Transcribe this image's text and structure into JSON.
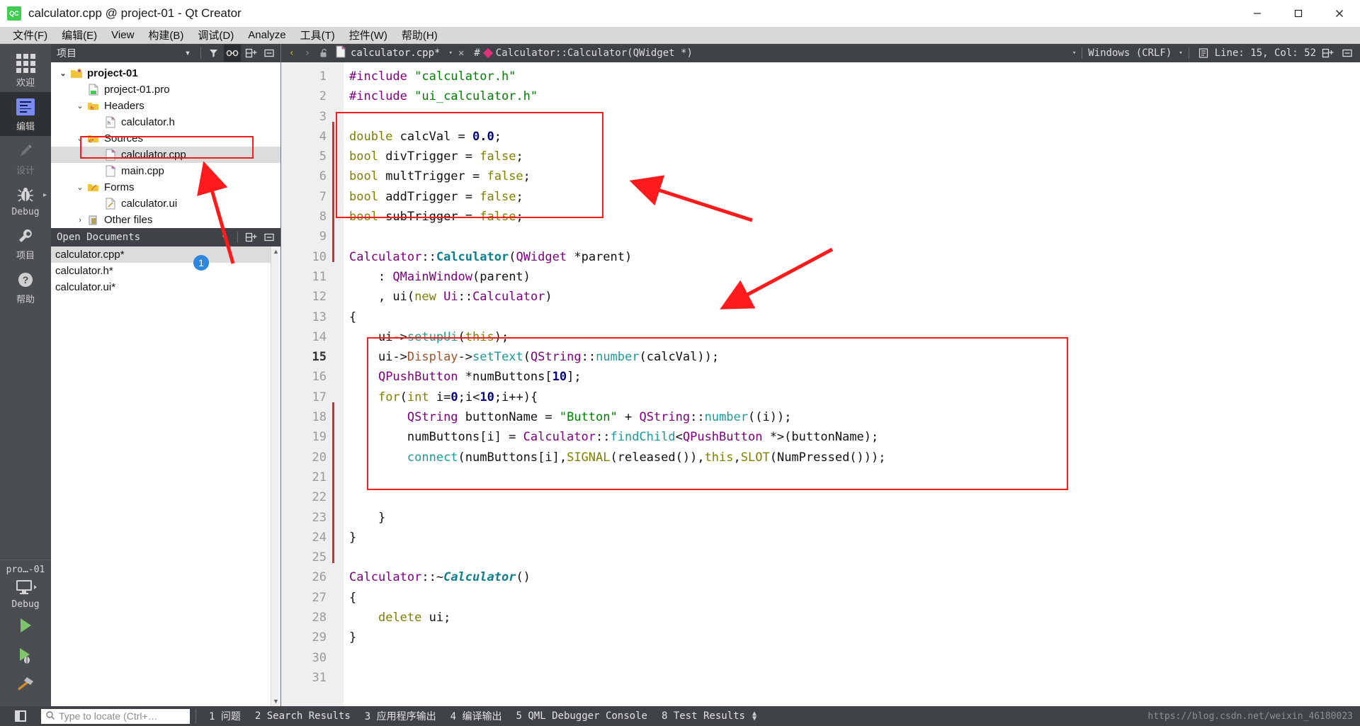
{
  "window": {
    "title": "calculator.cpp @ project-01 - Qt Creator",
    "logo_text": "QC",
    "minimize": "–",
    "maximize": "□",
    "close": "✕"
  },
  "menubar": {
    "items": [
      {
        "label": "文件(F)",
        "name": "menu-file"
      },
      {
        "label": "编辑(E)",
        "name": "menu-edit"
      },
      {
        "label": "View",
        "name": "menu-view"
      },
      {
        "label": "构建(B)",
        "name": "menu-build"
      },
      {
        "label": "调试(D)",
        "name": "menu-debug"
      },
      {
        "label": "Analyze",
        "name": "menu-analyze"
      },
      {
        "label": "工具(T)",
        "name": "menu-tools"
      },
      {
        "label": "控件(W)",
        "name": "menu-window"
      },
      {
        "label": "帮助(H)",
        "name": "menu-help"
      }
    ]
  },
  "modebar": {
    "items": [
      {
        "label": "欢迎",
        "icon": "grid-icon",
        "name": "mode-welcome",
        "active": false
      },
      {
        "label": "编辑",
        "icon": "edit-icon",
        "name": "mode-edit",
        "active": true
      },
      {
        "label": "设计",
        "icon": "pencil-icon",
        "name": "mode-design",
        "active": false
      },
      {
        "label": "Debug",
        "icon": "bug-icon",
        "name": "mode-debug",
        "active": false
      },
      {
        "label": "项目",
        "icon": "wrench-icon",
        "name": "mode-projects",
        "active": false
      },
      {
        "label": "帮助",
        "icon": "help-icon",
        "name": "mode-help",
        "active": false
      }
    ],
    "kit": {
      "project": "pro…-01",
      "build_config": "Debug",
      "run_icon": "play-icon",
      "debug_icon": "play-debug-icon",
      "build_icon": "hammer-icon"
    }
  },
  "project_panel": {
    "title": "项目",
    "tools": [
      "filter-icon",
      "link-icon",
      "split-icon",
      "close-panel-icon"
    ],
    "tree": [
      {
        "label": "project-01",
        "indent": 0,
        "arrow": "⌄",
        "icon": "project-icon",
        "bold": true,
        "selected": false
      },
      {
        "label": "project-01.pro",
        "indent": 1,
        "arrow": "",
        "icon": "pro-file-icon",
        "bold": false,
        "selected": false
      },
      {
        "label": "Headers",
        "indent": 1,
        "arrow": "⌄",
        "icon": "folder-h-icon",
        "bold": false,
        "selected": false
      },
      {
        "label": "calculator.h",
        "indent": 2,
        "arrow": "",
        "icon": "header-icon",
        "bold": false,
        "selected": false
      },
      {
        "label": "Sources",
        "indent": 1,
        "arrow": "⌄",
        "icon": "folder-c-icon",
        "bold": false,
        "selected": false
      },
      {
        "label": "calculator.cpp",
        "indent": 2,
        "arrow": "",
        "icon": "cpp-file-icon",
        "bold": false,
        "selected": true
      },
      {
        "label": "main.cpp",
        "indent": 2,
        "arrow": "",
        "icon": "cpp-file-icon",
        "bold": false,
        "selected": false
      },
      {
        "label": "Forms",
        "indent": 1,
        "arrow": "⌄",
        "icon": "folder-ui-icon",
        "bold": false,
        "selected": false
      },
      {
        "label": "calculator.ui",
        "indent": 2,
        "arrow": "",
        "icon": "ui-file-icon",
        "bold": false,
        "selected": false
      },
      {
        "label": "Other files",
        "indent": 1,
        "arrow": "›",
        "icon": "other-icon",
        "bold": false,
        "selected": false
      }
    ],
    "callout_number": "1"
  },
  "open_documents": {
    "title": "Open Documents",
    "items": [
      {
        "label": "calculator.cpp*",
        "selected": true
      },
      {
        "label": "calculator.h*",
        "selected": false
      },
      {
        "label": "calculator.ui*",
        "selected": false
      }
    ]
  },
  "editor_toolbar": {
    "back": "‹",
    "forward": "›",
    "lock_icon": "unlock-icon",
    "file_icon": "cpp-file-icon",
    "file_name": "calculator.cpp*",
    "close_label": "✕",
    "hash_label": "#",
    "symbol": "Calculator::Calculator(QWidget *)",
    "line_ending": "Windows (CRLF)",
    "cursor_position": "Line: 15, Col: 52",
    "split_icon": "split-icon",
    "close_split_icon": "close-split-icon"
  },
  "editor": {
    "first_line": 1,
    "last_line": 31,
    "current_line": 15,
    "fold_lines": [
      12,
      17,
      26
    ],
    "lines": [
      {
        "n": 1,
        "tokens": [
          {
            "t": "#include ",
            "c": "pre"
          },
          {
            "t": "\"calculator.h\"",
            "c": "str"
          }
        ]
      },
      {
        "n": 2,
        "tokens": [
          {
            "t": "#include ",
            "c": "pre"
          },
          {
            "t": "\"ui_calculator.h\"",
            "c": "str"
          }
        ]
      },
      {
        "n": 3,
        "tokens": []
      },
      {
        "n": 4,
        "tokens": [
          {
            "t": "double",
            "c": "kw"
          },
          {
            "t": " calcVal = ",
            "c": "op"
          },
          {
            "t": "0.0",
            "c": "num"
          },
          {
            "t": ";",
            "c": "op"
          }
        ]
      },
      {
        "n": 5,
        "tokens": [
          {
            "t": "bool",
            "c": "kw"
          },
          {
            "t": " divTrigger = ",
            "c": "op"
          },
          {
            "t": "false",
            "c": "kw"
          },
          {
            "t": ";",
            "c": "op"
          }
        ]
      },
      {
        "n": 6,
        "tokens": [
          {
            "t": "bool",
            "c": "kw"
          },
          {
            "t": " multTrigger = ",
            "c": "op"
          },
          {
            "t": "false",
            "c": "kw"
          },
          {
            "t": ";",
            "c": "op"
          }
        ]
      },
      {
        "n": 7,
        "tokens": [
          {
            "t": "bool",
            "c": "kw"
          },
          {
            "t": " addTrigger = ",
            "c": "op"
          },
          {
            "t": "false",
            "c": "kw"
          },
          {
            "t": ";",
            "c": "op"
          }
        ]
      },
      {
        "n": 8,
        "tokens": [
          {
            "t": "bool",
            "c": "kw"
          },
          {
            "t": " subTrigger = ",
            "c": "op"
          },
          {
            "t": "false",
            "c": "kw"
          },
          {
            "t": ";",
            "c": "op"
          }
        ]
      },
      {
        "n": 9,
        "tokens": []
      },
      {
        "n": 10,
        "tokens": [
          {
            "t": "Calculator",
            "c": "typ"
          },
          {
            "t": "::",
            "c": "op"
          },
          {
            "t": "Calculator",
            "c": "cls"
          },
          {
            "t": "(",
            "c": "op"
          },
          {
            "t": "QWidget",
            "c": "typ"
          },
          {
            "t": " *parent)",
            "c": "op"
          }
        ]
      },
      {
        "n": 11,
        "tokens": [
          {
            "t": "    : ",
            "c": "op"
          },
          {
            "t": "QMainWindow",
            "c": "typ"
          },
          {
            "t": "(parent)",
            "c": "op"
          }
        ]
      },
      {
        "n": 12,
        "tokens": [
          {
            "t": "    , ui(",
            "c": "op"
          },
          {
            "t": "new",
            "c": "kw"
          },
          {
            "t": " ",
            "c": "op"
          },
          {
            "t": "Ui",
            "c": "typ"
          },
          {
            "t": "::",
            "c": "op"
          },
          {
            "t": "Calculator",
            "c": "typ"
          },
          {
            "t": ")",
            "c": "op"
          }
        ]
      },
      {
        "n": 13,
        "tokens": [
          {
            "t": "{",
            "c": "op"
          }
        ]
      },
      {
        "n": 14,
        "tokens": [
          {
            "t": "    ui->",
            "c": "op"
          },
          {
            "t": "setupUi",
            "c": "fn"
          },
          {
            "t": "(",
            "c": "op"
          },
          {
            "t": "this",
            "c": "kw"
          },
          {
            "t": ");",
            "c": "op"
          }
        ]
      },
      {
        "n": 15,
        "tokens": [
          {
            "t": "    ui->",
            "c": "op"
          },
          {
            "t": "Display",
            "c": "fld"
          },
          {
            "t": "->",
            "c": "op"
          },
          {
            "t": "setText",
            "c": "fn"
          },
          {
            "t": "(",
            "c": "op"
          },
          {
            "t": "QString",
            "c": "typ"
          },
          {
            "t": "::",
            "c": "op"
          },
          {
            "t": "number",
            "c": "fn"
          },
          {
            "t": "(calcVal));",
            "c": "op"
          }
        ]
      },
      {
        "n": 16,
        "tokens": [
          {
            "t": "    ",
            "c": "op"
          },
          {
            "t": "QPushButton",
            "c": "typ"
          },
          {
            "t": " *numButtons[",
            "c": "op"
          },
          {
            "t": "10",
            "c": "num"
          },
          {
            "t": "];",
            "c": "op"
          }
        ]
      },
      {
        "n": 17,
        "tokens": [
          {
            "t": "    ",
            "c": "op"
          },
          {
            "t": "for",
            "c": "kw"
          },
          {
            "t": "(",
            "c": "op"
          },
          {
            "t": "int",
            "c": "kw"
          },
          {
            "t": " i=",
            "c": "op"
          },
          {
            "t": "0",
            "c": "num"
          },
          {
            "t": ";i<",
            "c": "op"
          },
          {
            "t": "10",
            "c": "num"
          },
          {
            "t": ";i++){",
            "c": "op"
          }
        ]
      },
      {
        "n": 18,
        "tokens": [
          {
            "t": "        ",
            "c": "op"
          },
          {
            "t": "QString",
            "c": "typ"
          },
          {
            "t": " buttonName = ",
            "c": "op"
          },
          {
            "t": "\"Button\"",
            "c": "str"
          },
          {
            "t": " + ",
            "c": "op"
          },
          {
            "t": "QString",
            "c": "typ"
          },
          {
            "t": "::",
            "c": "op"
          },
          {
            "t": "number",
            "c": "fn"
          },
          {
            "t": "((i));",
            "c": "op"
          }
        ]
      },
      {
        "n": 19,
        "tokens": [
          {
            "t": "        numButtons[i] = ",
            "c": "op"
          },
          {
            "t": "Calculator",
            "c": "typ"
          },
          {
            "t": "::",
            "c": "op"
          },
          {
            "t": "findChild",
            "c": "fn"
          },
          {
            "t": "<",
            "c": "op"
          },
          {
            "t": "QPushButton",
            "c": "typ"
          },
          {
            "t": " *>(buttonName);",
            "c": "op"
          }
        ]
      },
      {
        "n": 20,
        "tokens": [
          {
            "t": "        ",
            "c": "op"
          },
          {
            "t": "connect",
            "c": "fn"
          },
          {
            "t": "(numButtons[i],",
            "c": "op"
          },
          {
            "t": "SIGNAL",
            "c": "mac"
          },
          {
            "t": "(released()),",
            "c": "op"
          },
          {
            "t": "this",
            "c": "kw"
          },
          {
            "t": ",",
            "c": "op"
          },
          {
            "t": "SLOT",
            "c": "mac"
          },
          {
            "t": "(NumPressed()));",
            "c": "op"
          }
        ]
      },
      {
        "n": 21,
        "tokens": []
      },
      {
        "n": 22,
        "tokens": []
      },
      {
        "n": 23,
        "tokens": [
          {
            "t": "    }",
            "c": "op"
          }
        ]
      },
      {
        "n": 24,
        "tokens": [
          {
            "t": "}",
            "c": "op"
          }
        ]
      },
      {
        "n": 25,
        "tokens": []
      },
      {
        "n": 26,
        "tokens": [
          {
            "t": "Calculator",
            "c": "typ"
          },
          {
            "t": "::~",
            "c": "op"
          },
          {
            "t": "Calculator",
            "c": "cls-i"
          },
          {
            "t": "()",
            "c": "op"
          }
        ]
      },
      {
        "n": 27,
        "tokens": [
          {
            "t": "{",
            "c": "op"
          }
        ]
      },
      {
        "n": 28,
        "tokens": [
          {
            "t": "    ",
            "c": "op"
          },
          {
            "t": "delete",
            "c": "kw"
          },
          {
            "t": " ui;",
            "c": "op"
          }
        ]
      },
      {
        "n": 29,
        "tokens": [
          {
            "t": "}",
            "c": "op"
          }
        ]
      },
      {
        "n": 30,
        "tokens": []
      },
      {
        "n": 31,
        "tokens": []
      }
    ]
  },
  "annotations": {
    "accent_color": "#ff1b1b",
    "badge_color": "#2e86de",
    "badge_label": "1",
    "boxes": [
      "declarations-block",
      "constructor-body-block",
      "sidebar-file-highlight"
    ],
    "arrows": [
      "arrow-to-declarations",
      "arrow-to-constructor-body",
      "arrow-to-sidebar-file"
    ]
  },
  "statusbar": {
    "sidebar_toggle": "sidebar-toggle-icon",
    "locate_placeholder": "Type to locate (Ctrl+…",
    "search_icon": "search-icon",
    "outputs": [
      {
        "num": "1",
        "label": "问题"
      },
      {
        "num": "2",
        "label": "Search Results"
      },
      {
        "num": "3",
        "label": "应用程序输出"
      },
      {
        "num": "4",
        "label": "编译输出"
      },
      {
        "num": "5",
        "label": "QML Debugger Console"
      },
      {
        "num": "8",
        "label": "Test Results"
      }
    ],
    "watermark": "https://blog.csdn.net/weixin_46180023"
  }
}
